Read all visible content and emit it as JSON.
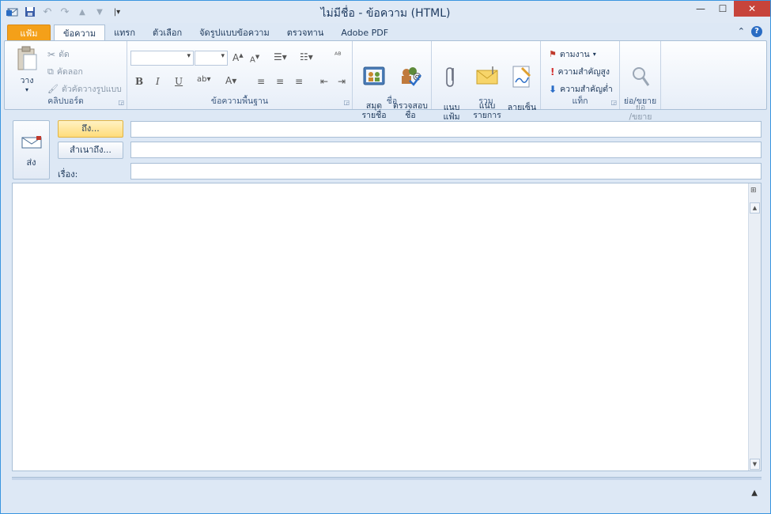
{
  "window": {
    "title": "ไม่มีชื่อ - ข้อความ (HTML)",
    "accent": "#2c8fe0"
  },
  "qat": [
    "outlook-icon",
    "save-icon",
    "undo-icon",
    "redo-icon",
    "up-icon",
    "down-icon",
    "customize-icon"
  ],
  "tabs": [
    {
      "label": "แฟ้ม"
    },
    {
      "label": "ข้อความ"
    },
    {
      "label": "แทรก"
    },
    {
      "label": "ตัวเลือก"
    },
    {
      "label": "จัดรูปแบบข้อความ"
    },
    {
      "label": "ตรวจทาน"
    },
    {
      "label": "Adobe PDF"
    }
  ],
  "ribbon": {
    "clipboard": {
      "label": "คลิปบอร์ด",
      "paste": "วาง",
      "cut": "ตัด",
      "copy": "คัดลอก",
      "format_painter": "ตัวคัดวางรูปแบบ"
    },
    "basic_text": {
      "label": "ข้อความพื้นฐาน"
    },
    "names": {
      "label": "ชื่อ",
      "address_book": "สมุด\nรายชื่อ",
      "check_names": "ตรวจสอบ\nชื่อ"
    },
    "include": {
      "label": "รวม",
      "attach_file": "แนบ\nแฟ้ม",
      "attach_item": "แนบ\nรายการ",
      "signature": "ลายเซ็น"
    },
    "tags": {
      "label": "แท็ก",
      "follow_up": "ตามงาน",
      "high_importance": "ความสำคัญสูง",
      "low_importance": "ความสำคัญต่ำ"
    },
    "zoom": {
      "label": "ย่อ/ขยาย",
      "zoom_btn": "ย่อ\n/ขยาย"
    }
  },
  "compose": {
    "send": "ส่ง",
    "to_btn": "ถึง...",
    "cc_btn": "สำเนาถึง...",
    "subject_label": "เรื่อง:",
    "to_value": "",
    "cc_value": "",
    "subject_value": ""
  }
}
